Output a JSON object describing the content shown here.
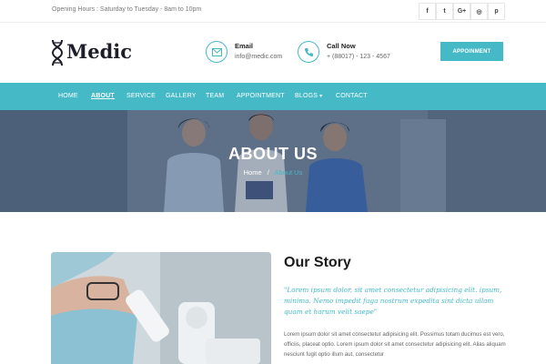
{
  "topbar": {
    "hours": "Opening Hours : Saturday to Tuesday - 8am to 10pm",
    "social": [
      {
        "icon": "facebook-icon",
        "glyph": "f"
      },
      {
        "icon": "twitter-icon",
        "glyph": "t"
      },
      {
        "icon": "google-plus-icon",
        "glyph": "G+"
      },
      {
        "icon": "instagram-icon",
        "glyph": "◎"
      },
      {
        "icon": "pinterest-icon",
        "glyph": "p"
      }
    ]
  },
  "header": {
    "logo_text": "Medic",
    "email": {
      "title": "Email",
      "value": "info@medic.com",
      "icon": "envelope-icon"
    },
    "call": {
      "title": "Call Now",
      "value": "+ (88017) - 123 - 4567",
      "icon": "phone-icon"
    },
    "cta_label": "APPOINMENT"
  },
  "nav": {
    "items": [
      {
        "label": "HOME",
        "active": false
      },
      {
        "label": "ABOUT",
        "active": true
      },
      {
        "label": "SERVICE",
        "active": false
      },
      {
        "label": "GALLERY",
        "active": false
      },
      {
        "label": "TEAM",
        "active": false
      },
      {
        "label": "APPOINTMENT",
        "active": false
      },
      {
        "label": "BLOGS",
        "active": false,
        "dropdown": true
      },
      {
        "label": "CONTACT",
        "active": false
      }
    ]
  },
  "hero": {
    "title": "ABOUT US",
    "breadcrumb": {
      "home": "Home",
      "separator": "/",
      "current": "About Us"
    }
  },
  "story": {
    "title": "Our Story",
    "quote": "\"Lorem ipsum dolor, sit amet consectetur adipisicing elit. ipsum, minima. Nemo impedit fuga nostrum expedita sint dicta ullam quam et harum velit saepe\"",
    "body": "Lorem ipsum dolor sit amet consectetur adipisicing elit. Possimus totam ducimus est vero, officiis, placeat optio. Lorem ipsum dolor sit amet consectetur adipisicing elit. Alias aliquam nesciunt fugit optio illum aut, consectetur"
  },
  "colors": {
    "accent": "#45b9c6",
    "text_dark": "#1b1b1b",
    "text_muted": "#666666"
  }
}
